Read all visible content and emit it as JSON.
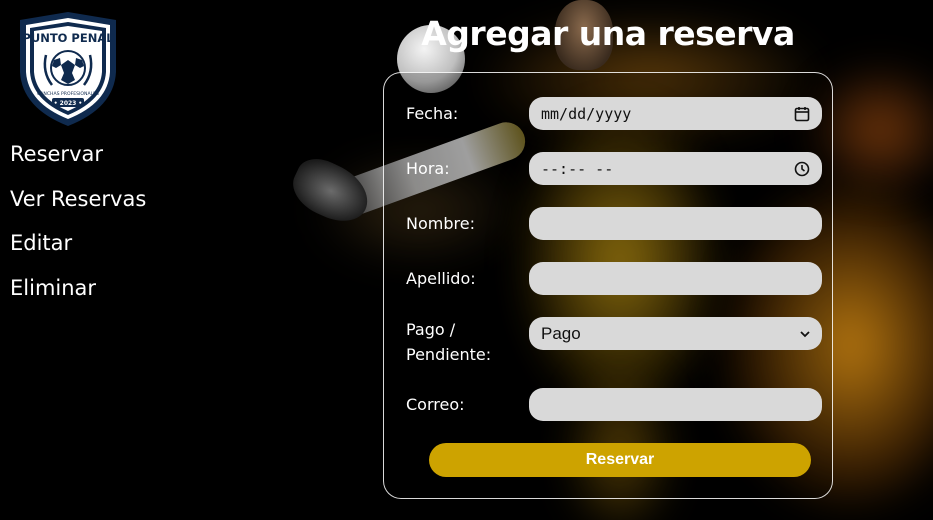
{
  "logo": {
    "brand_top": "PUNTO PENAL",
    "brand_sub": "CANCHAS PROFESIONALES",
    "year": "• 2023 •"
  },
  "nav": {
    "items": [
      "Reservar",
      "Ver Reservas",
      "Editar",
      "Eliminar"
    ]
  },
  "form": {
    "title": "Agregar una reserva",
    "fields": {
      "fecha": {
        "label": "Fecha:",
        "value": "mm/dd/yyyy",
        "icon": "calendar-icon"
      },
      "hora": {
        "label": "Hora:",
        "value": "--:-- --",
        "icon": "clock-icon"
      },
      "nombre": {
        "label": "Nombre:",
        "value": ""
      },
      "apellido": {
        "label": "Apellido:",
        "value": ""
      },
      "pago": {
        "label_line1": "Pago /",
        "label_line2": "Pendiente:",
        "value": "Pago",
        "icon": "chevron-down-icon"
      },
      "correo": {
        "label": "Correo:",
        "value": ""
      }
    },
    "submit_label": "Reservar"
  },
  "colors": {
    "accent": "#cda300",
    "field_bg": "#d9d9d9",
    "logo_navy": "#0f2a4e"
  }
}
